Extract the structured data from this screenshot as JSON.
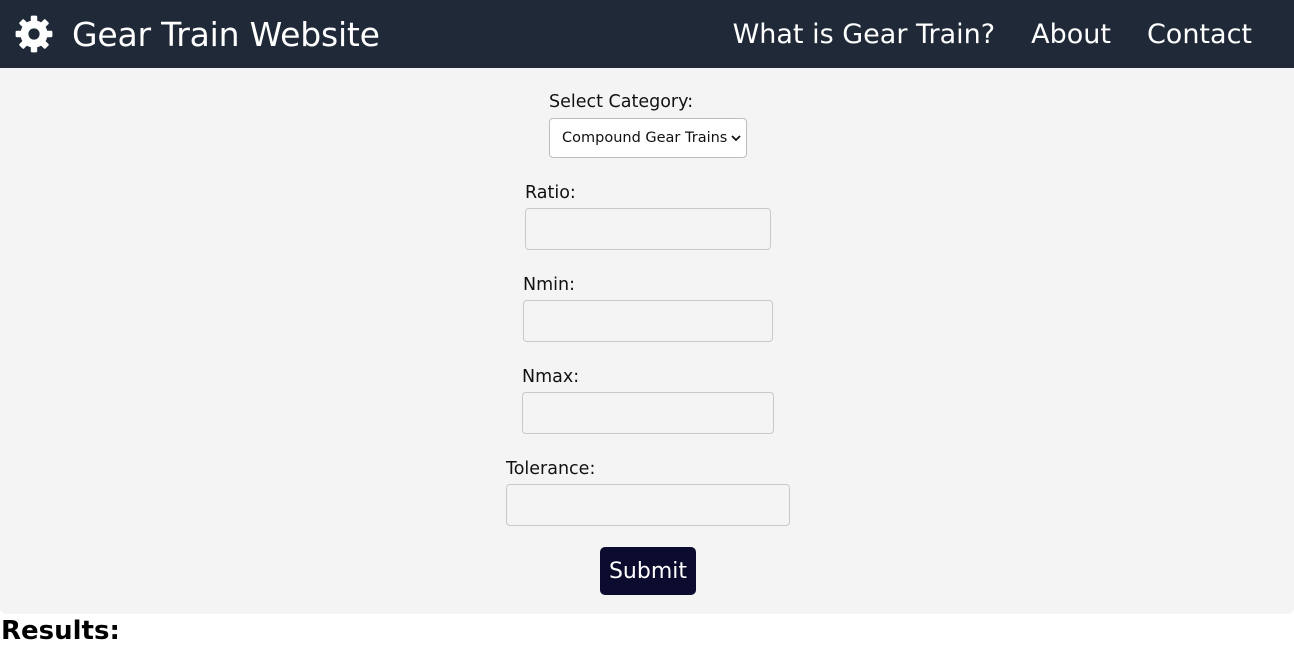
{
  "header": {
    "brand_icon": "gear-icon",
    "title": "Gear Train Website",
    "nav": [
      {
        "label": "What is Gear Train?"
      },
      {
        "label": "About"
      },
      {
        "label": "Contact"
      }
    ]
  },
  "form": {
    "category_label": "Select Category:",
    "category_value": "Compound Gear Trains",
    "ratio_label": "Ratio:",
    "ratio_value": "",
    "nmin_label": "Nmin:",
    "nmin_value": "",
    "nmax_label": "Nmax:",
    "nmax_value": "",
    "tolerance_label": "Tolerance:",
    "tolerance_value": "",
    "submit_label": "Submit"
  },
  "results": {
    "heading": "Results:"
  },
  "colors": {
    "navbar_bg": "#1f2937",
    "panel_bg": "#f4f4f5",
    "submit_bg": "#0b0b2d"
  }
}
